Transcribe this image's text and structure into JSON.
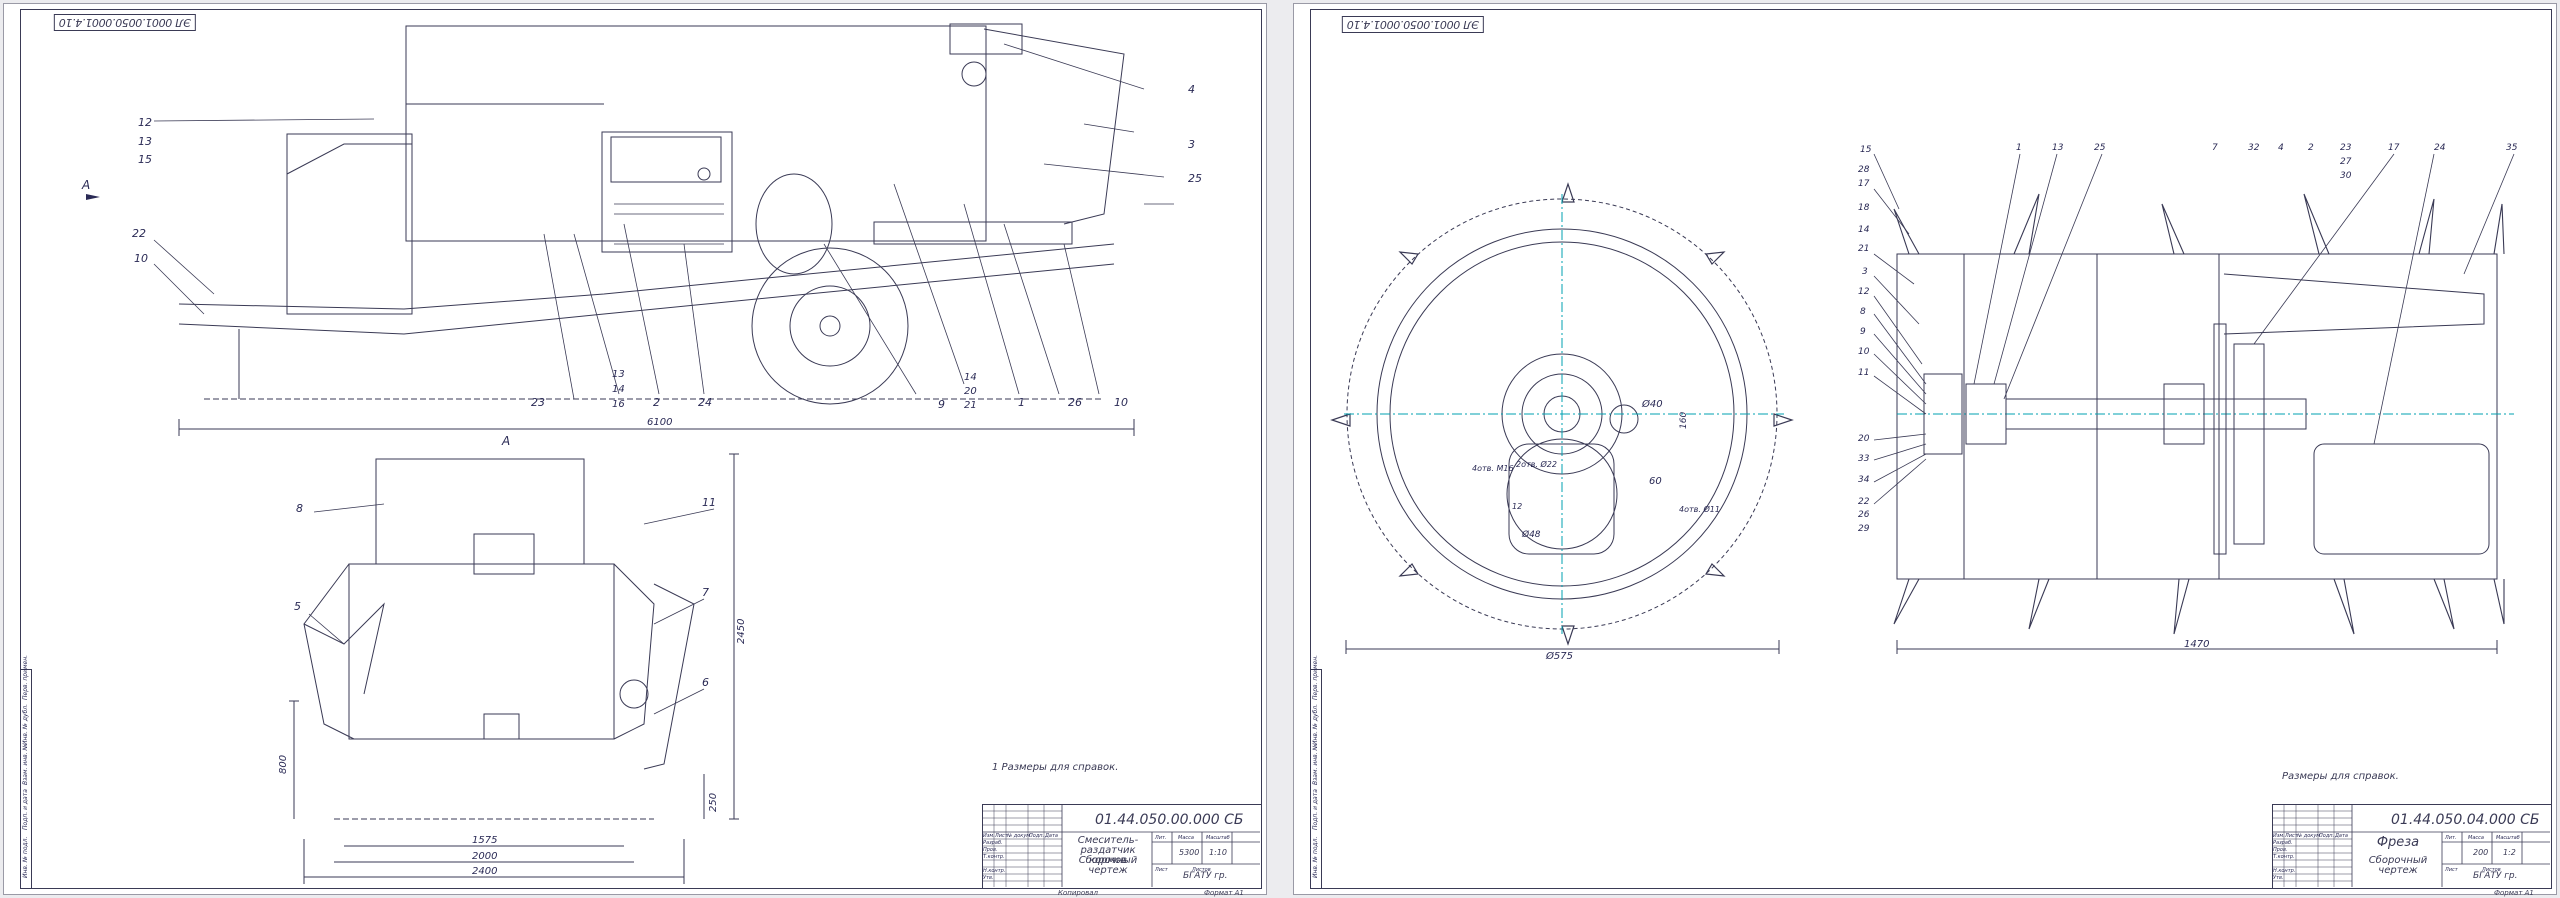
{
  "sheets": [
    {
      "id": "assembly",
      "code_stamp": "ЭЛ 0001.0050.0001.4.10",
      "doc_code": "01.44.050.00.000 СБ",
      "doc_name": "Смеситель-раздатчик кормов",
      "doc_type": "Сборочный чертеж",
      "org": "БГАТУ гр.",
      "scale": "1:10",
      "mass": "5300",
      "note": "1 Размеры для справок.",
      "footer_left": "Копировал",
      "footer_right": "Формат А1",
      "view_label": "А",
      "view_label_side": "А",
      "dimensions": {
        "overall_length": "6100",
        "width_1": "1575",
        "width_2": "2000",
        "width_3": "2400",
        "height": "2450",
        "h_800": "800",
        "h_250": "250"
      },
      "callouts": {
        "top_right": [
          "4",
          "3",
          "25"
        ],
        "left": [
          "12",
          "13",
          "15",
          "22",
          "10"
        ],
        "bottom": [
          "23",
          "13",
          "14",
          "16",
          "2",
          "24",
          "9",
          "14",
          "20",
          "21",
          "1",
          "26",
          "10"
        ],
        "front": [
          "8",
          "11",
          "5",
          "7",
          "6"
        ]
      }
    },
    {
      "id": "cutter",
      "code_stamp": "ЭЛ 0001.0050.0001.4.10",
      "doc_code": "01.44.050.04.000 СБ",
      "doc_name": "Фреза",
      "doc_type": "Сборочный чертеж",
      "org": "БГАТУ гр.",
      "scale": "1:2",
      "mass": "200",
      "note": "Размеры для справок.",
      "footer_right": "Формат А1",
      "dimensions": {
        "diameter": "Ø575",
        "length": "1470",
        "hole_40": "Ø40",
        "dim_60": "60",
        "dim_160": "160",
        "dim_48": "Ø48",
        "thread_m": "4отв. М16",
        "holes_22": "2отв. Ø22",
        "holes_11": "4отв. Ø11",
        "dim_12": "12"
      },
      "callouts": {
        "left": [
          "15",
          "28",
          "17",
          "18",
          "14",
          "21",
          "3",
          "12",
          "8",
          "9",
          "10",
          "11",
          "20",
          "33",
          "34",
          "22",
          "26",
          "29"
        ],
        "top": [
          "1",
          "13",
          "25",
          "7",
          "32",
          "4",
          "2",
          "23",
          "27",
          "30",
          "17",
          "24",
          "35"
        ]
      }
    }
  ],
  "title_block_labels": [
    "Изм.",
    "Лист",
    "№ докум.",
    "Подп.",
    "Дата",
    "Разраб.",
    "Пров.",
    "Т.контр.",
    "Н.контр.",
    "Утв.",
    "Лит.",
    "Масса",
    "Масштаб",
    "Лист",
    "Листов"
  ],
  "side_strip_labels": [
    "Перв. примен.",
    "Справ. №",
    "Подп. и дата",
    "Инв. № дубл.",
    "Взам. инв. №",
    "Подп. и дата",
    "Инв. № подл."
  ],
  "colors": {
    "line": "#3a3a55",
    "axis": "#00a0b0",
    "paper": "#ffffff",
    "bg": "#ececef"
  }
}
